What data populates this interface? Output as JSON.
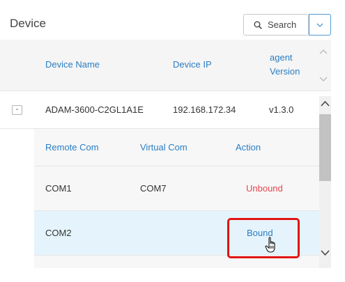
{
  "page": {
    "title": "Device"
  },
  "toolbar": {
    "search_label": "Search"
  },
  "table": {
    "headers": {
      "device_name": "Device Name",
      "device_ip": "Device IP",
      "agent_version_line1": "agent",
      "agent_version_line2": "Version"
    },
    "device": {
      "collapse_symbol": "-",
      "name": "ADAM-3600-C2GL1A1E",
      "ip": "192.168.172.34",
      "version": "v1.3.0"
    },
    "sub_table": {
      "headers": {
        "remote_com": "Remote Com",
        "virtual_com": "Virtual Com",
        "action": "Action"
      },
      "rows": [
        {
          "remote_com": "COM1",
          "virtual_com": "COM7",
          "action": "Unbound"
        },
        {
          "remote_com": "COM2",
          "virtual_com": "",
          "action": "Bound"
        }
      ]
    }
  },
  "colors": {
    "link_blue": "#2a7dc3",
    "unbound_red": "#e0474e",
    "highlight_red": "#e01414",
    "selected_row": "#e5f4fc"
  }
}
